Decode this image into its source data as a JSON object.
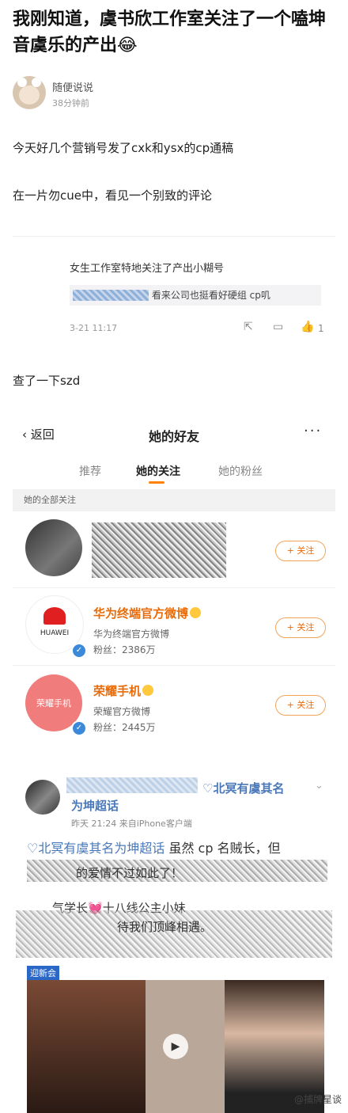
{
  "article": {
    "title": "我刚知道，虞书欣工作室关注了一个嗑坤音虞乐的产出😂",
    "author": "随便说说",
    "time_ago": "38分钟前",
    "para1": "今天好几个营销号发了cxk和ysx的cp通稿",
    "para2": "在一片勿cue中，看见一个别致的评论",
    "para3": "查了一下szd"
  },
  "comment": {
    "text": "女生工作室特地关注了产出小糊号",
    "reply": "看来公司也挺看好硬组 cp叽",
    "time": "3-21 11:17",
    "likes": "1"
  },
  "friends": {
    "back_label": "返回",
    "title": "她的好友",
    "more": "···",
    "tabs": [
      "推荐",
      "她的关注",
      "她的粉丝"
    ],
    "section_label": "她的全部关注",
    "follow_label": "+ 关注",
    "rows": [
      {
        "name": "",
        "sub1": "",
        "sub2": ""
      },
      {
        "name": "华为终端官方微博",
        "sub1": "华为终端官方微博",
        "sub2": "粉丝：2386万",
        "logo": "HUAWEI"
      },
      {
        "name": "荣耀手机",
        "sub1": "荣耀官方微博",
        "sub2": "粉丝：2445万",
        "logo": "荣耀手机"
      }
    ]
  },
  "post": {
    "name_part1": "北冥有虞其名",
    "name_part2": "为坤超话",
    "meta": "昨天 21:24  来自iPhone客户端",
    "line1_topic": "北冥有虞其名为坤超话",
    "line1_rest": " 虽然 cp 名贼长，但",
    "line2": "气学长💓十八线公主小妹",
    "line3": "待我们顶峰相遇。",
    "partial": "的爱情不过如此了！",
    "video_tag": "迎新会"
  },
  "watermark": "@捕牌星谈",
  "colors": {
    "accent": "#ff8200",
    "link": "#4a78b8",
    "follow": "#e86b0a"
  }
}
